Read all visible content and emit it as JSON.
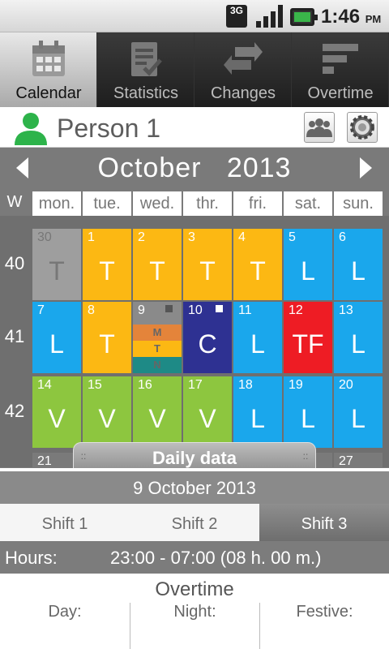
{
  "status": {
    "network": "3G",
    "time": "1:46",
    "ampm": "PM"
  },
  "tabs": [
    {
      "label": "Calendar",
      "active": true
    },
    {
      "label": "Statistics",
      "active": false
    },
    {
      "label": "Changes",
      "active": false
    },
    {
      "label": "Overtime",
      "active": false
    }
  ],
  "person": {
    "name": "Person 1"
  },
  "calendar": {
    "month": "October",
    "year": "2013",
    "week_header": "W",
    "weekdays": [
      "mon.",
      "tue.",
      "wed.",
      "thr.",
      "fri.",
      "sat.",
      "sun."
    ],
    "weeks": [
      {
        "week": "40",
        "days": [
          {
            "n": "30",
            "code": "T",
            "color": "#9e9e9e",
            "out": true
          },
          {
            "n": "1",
            "code": "T",
            "color": "#fcb813"
          },
          {
            "n": "2",
            "code": "T",
            "color": "#fcb813"
          },
          {
            "n": "3",
            "code": "T",
            "color": "#fcb813"
          },
          {
            "n": "4",
            "code": "T",
            "color": "#fcb813"
          },
          {
            "n": "5",
            "code": "L",
            "color": "#1aa7ec"
          },
          {
            "n": "6",
            "code": "L",
            "color": "#1aa7ec"
          }
        ]
      },
      {
        "week": "41",
        "days": [
          {
            "n": "7",
            "code": "L",
            "color": "#1aa7ec"
          },
          {
            "n": "8",
            "code": "T",
            "color": "#fcb813"
          },
          {
            "n": "9",
            "code": "",
            "color": "#8a8a8a",
            "split": [
              "M",
              "T",
              "N"
            ],
            "marker": "#555"
          },
          {
            "n": "10",
            "code": "C",
            "color": "#2e3192",
            "marker": "#ffffff"
          },
          {
            "n": "11",
            "code": "L",
            "color": "#1aa7ec"
          },
          {
            "n": "12",
            "code": "TF",
            "color": "#ee1c24"
          },
          {
            "n": "13",
            "code": "L",
            "color": "#1aa7ec"
          }
        ]
      },
      {
        "week": "42",
        "days": [
          {
            "n": "14",
            "code": "V",
            "color": "#8dc63f"
          },
          {
            "n": "15",
            "code": "V",
            "color": "#8dc63f"
          },
          {
            "n": "16",
            "code": "V",
            "color": "#8dc63f"
          },
          {
            "n": "17",
            "code": "V",
            "color": "#8dc63f"
          },
          {
            "n": "18",
            "code": "L",
            "color": "#1aa7ec"
          },
          {
            "n": "19",
            "code": "L",
            "color": "#1aa7ec"
          },
          {
            "n": "20",
            "code": "L",
            "color": "#1aa7ec"
          }
        ]
      },
      {
        "week": "",
        "days": [
          {
            "n": "21",
            "code": "",
            "color": "#7a7a7a"
          },
          {
            "n": "",
            "code": "",
            "color": "#7a7a7a"
          },
          {
            "n": "",
            "code": "",
            "color": "#7a7a7a"
          },
          {
            "n": "",
            "code": "",
            "color": "#7a7a7a"
          },
          {
            "n": "",
            "code": "",
            "color": "#7a7a7a"
          },
          {
            "n": "",
            "code": "",
            "color": "#7a7a7a"
          },
          {
            "n": "27",
            "code": "",
            "color": "#7a7a7a"
          }
        ]
      }
    ],
    "split_colors": [
      "#e4843a",
      "#fcb813",
      "#1e8a86"
    ]
  },
  "daily": {
    "handle_label": "Daily data",
    "date": "9 October 2013",
    "shifts": [
      {
        "label": "Shift 1",
        "active": false
      },
      {
        "label": "Shift 2",
        "active": false
      },
      {
        "label": "Shift 3",
        "active": true
      }
    ],
    "hours_label": "Hours:",
    "hours_value": "23:00 - 07:00   (08 h. 00 m.)",
    "overtime_title": "Overtime",
    "overtime_cols": [
      "Day:",
      "Night:",
      "Festive:"
    ]
  }
}
